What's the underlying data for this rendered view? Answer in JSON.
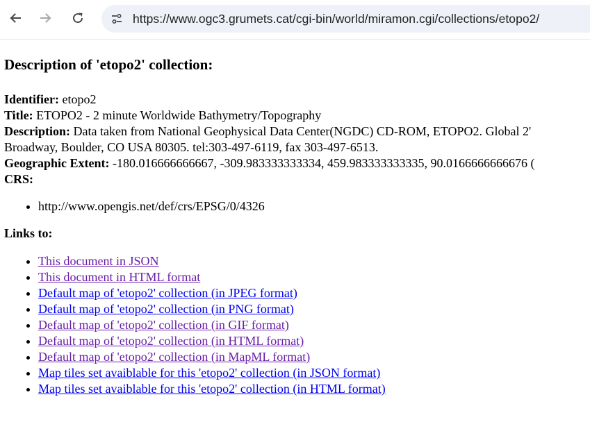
{
  "browser": {
    "url": "https://www.ogc3.grumets.cat/cgi-bin/world/miramon.cgi/collections/etopo2/",
    "icons": [
      "back-arrow-icon",
      "forward-arrow-icon",
      "reload-icon",
      "site-settings-icon"
    ]
  },
  "page": {
    "heading": "Description of 'etopo2' collection:",
    "identifier_label": "Identifier:",
    "identifier_value": "etopo2",
    "title_label": "Title:",
    "title_value": "ETOPO2 - 2 minute Worldwide Bathymetry/Topography",
    "description_label": "Description:",
    "description_value_line1": "Data taken from National Geophysical Data Center(NGDC) CD-ROM, ETOPO2. Global 2'",
    "description_value_line2": "Broadway, Boulder, CO USA 80305. tel:303-497-6119, fax 303-497-6513.",
    "extent_label": "Geographic Extent:",
    "extent_value": "-180.016666666667, -309.983333333334, 459.983333333335, 90.0166666666676 (",
    "crs_label": "CRS:",
    "crs_items": [
      "http://www.opengis.net/def/crs/EPSG/0/4326"
    ],
    "links_heading": "Links to:",
    "links": [
      {
        "label": "This document in JSON",
        "visited": true
      },
      {
        "label": "This document in HTML format",
        "visited": true
      },
      {
        "label": "Default map of 'etopo2' collection (in JPEG format)",
        "visited": false
      },
      {
        "label": "Default map of 'etopo2' collection (in PNG format)",
        "visited": false
      },
      {
        "label": "Default map of 'etopo2' collection (in GIF format)",
        "visited": true
      },
      {
        "label": "Default map of 'etopo2' collection (in HTML format)",
        "visited": true
      },
      {
        "label": "Default map of 'etopo2' collection (in MapML format)",
        "visited": true
      },
      {
        "label": "Map tiles set avaiblable for this 'etopo2' collection (in JSON format)",
        "visited": false
      },
      {
        "label": "Map tiles set avaiblable for this 'etopo2' collection (in HTML format)",
        "visited": false
      }
    ]
  },
  "colors": {
    "link_visited": "#681da8",
    "link_unvisited": "#0000ee",
    "omnibox_bg": "#eef1f8"
  }
}
